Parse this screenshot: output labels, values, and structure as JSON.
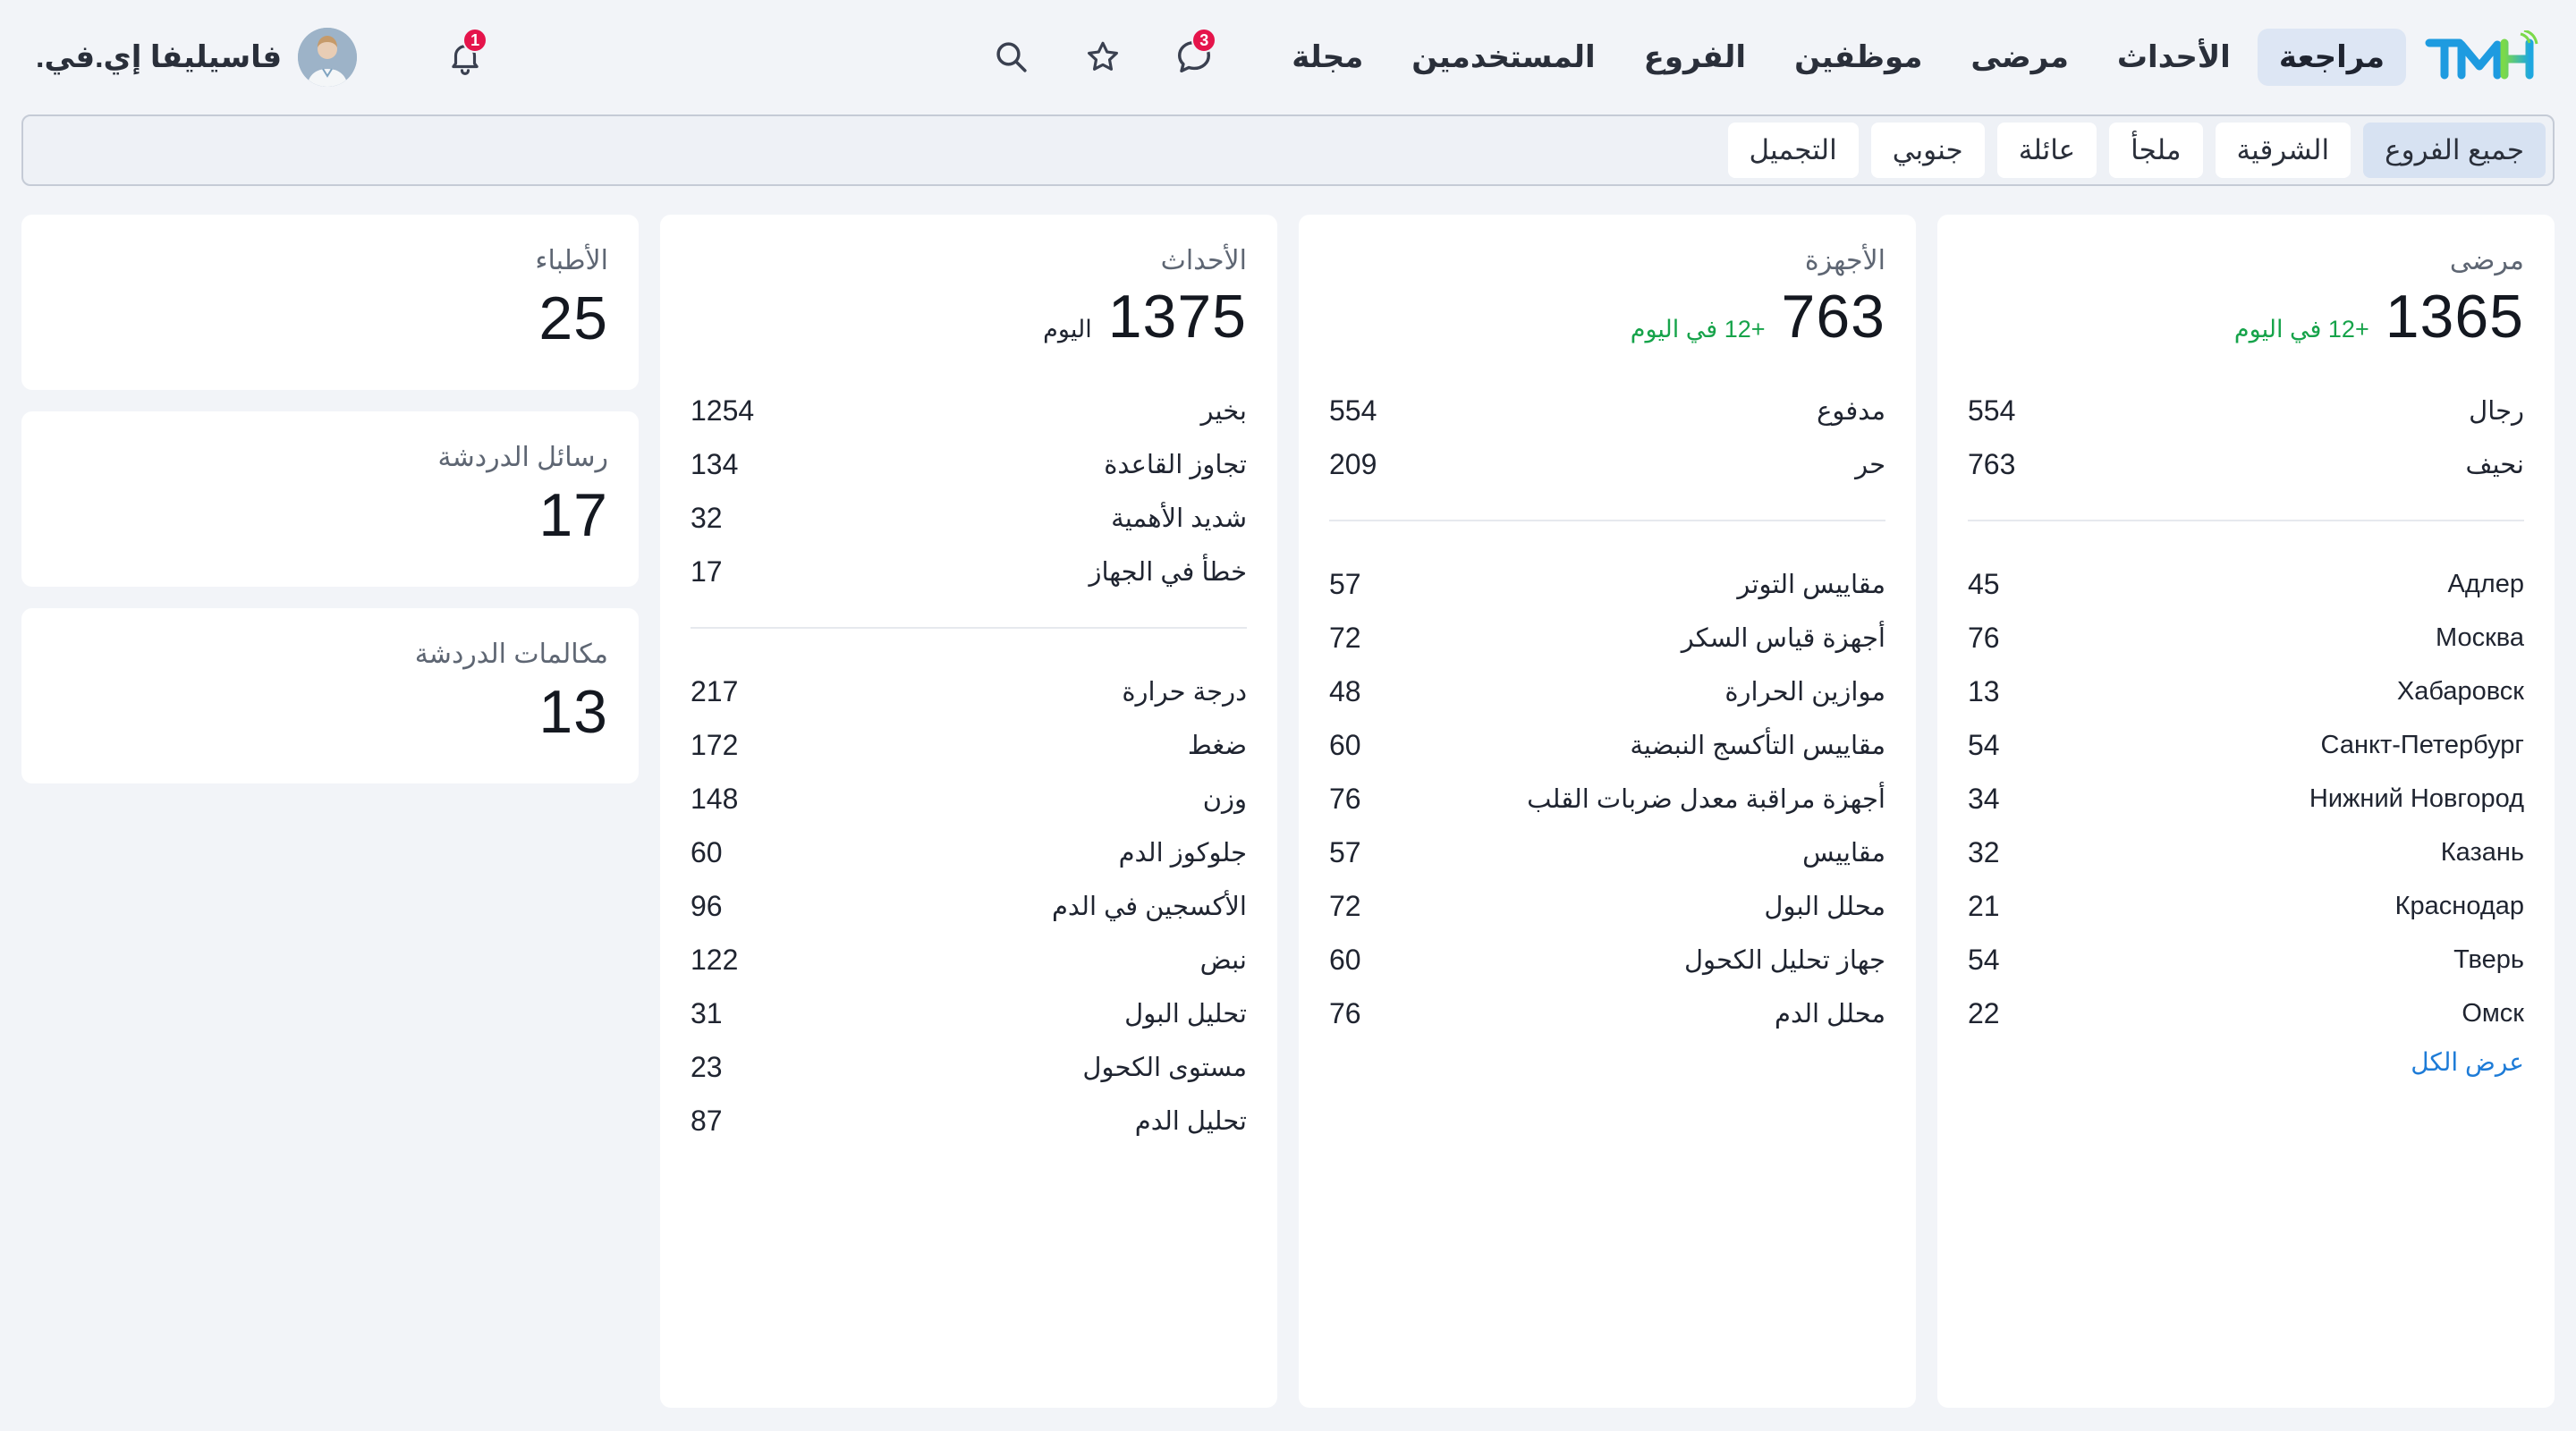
{
  "header": {
    "logo_text": "TMH",
    "nav": [
      "مراجعة",
      "الأحداث",
      "مرضى",
      "موظفين",
      "الفروع",
      "المستخدمين",
      "مجلة"
    ],
    "chat_badge": "3",
    "notif_badge": "1",
    "user_name": "فاسيليفا إي.في."
  },
  "filters": [
    "جميع الفروع",
    "الشرقية",
    "ملجأ",
    "عائلة",
    "جنوبي",
    "التجميل"
  ],
  "patients": {
    "title": "مرضى",
    "total": "1365",
    "delta": "+12 في اليوم",
    "group1": [
      {
        "label": "رجال",
        "value": "554"
      },
      {
        "label": "نحيف",
        "value": "763"
      }
    ],
    "group2": [
      {
        "label": "Адлер",
        "value": "45"
      },
      {
        "label": "Москва",
        "value": "76"
      },
      {
        "label": "Хабаровск",
        "value": "13"
      },
      {
        "label": "Санкт-Петербург",
        "value": "54"
      },
      {
        "label": "Нижний Новгород",
        "value": "34"
      },
      {
        "label": "Казань",
        "value": "32"
      },
      {
        "label": "Краснодар",
        "value": "21"
      },
      {
        "label": "Тверь",
        "value": "54"
      },
      {
        "label": "Омск",
        "value": "22"
      }
    ],
    "show_all": "عرض الكل"
  },
  "devices": {
    "title": "الأجهزة",
    "total": "763",
    "delta": "+12 في اليوم",
    "group1": [
      {
        "label": "مدفوع",
        "value": "554"
      },
      {
        "label": "حر",
        "value": "209"
      }
    ],
    "group2": [
      {
        "label": "مقاييس التوتر",
        "value": "57"
      },
      {
        "label": "أجهزة قياس السكر",
        "value": "72"
      },
      {
        "label": "موازين الحرارة",
        "value": "48"
      },
      {
        "label": "مقاييس التأكسج النبضية",
        "value": "60"
      },
      {
        "label": "أجهزة مراقبة معدل ضربات القلب",
        "value": "76"
      },
      {
        "label": "مقاييس",
        "value": "57"
      },
      {
        "label": "محلل البول",
        "value": "72"
      },
      {
        "label": "جهاز تحليل الكحول",
        "value": "60"
      },
      {
        "label": "محلل الدم",
        "value": "76"
      }
    ]
  },
  "events": {
    "title": "الأحداث",
    "total": "1375",
    "sub": "اليوم",
    "group1": [
      {
        "label": "بخير",
        "value": "1254"
      },
      {
        "label": "تجاوز القاعدة",
        "value": "134"
      },
      {
        "label": "شديد الأهمية",
        "value": "32"
      },
      {
        "label": "خطأ في الجهاز",
        "value": "17"
      }
    ],
    "group2": [
      {
        "label": "درجة حرارة",
        "value": "217"
      },
      {
        "label": "ضغط",
        "value": "172"
      },
      {
        "label": "وزن",
        "value": "148"
      },
      {
        "label": "جلوكوز الدم",
        "value": "60"
      },
      {
        "label": "الأكسجين في الدم",
        "value": "96"
      },
      {
        "label": "نبض",
        "value": "122"
      },
      {
        "label": "تحليل البول",
        "value": "31"
      },
      {
        "label": "مستوى الكحول",
        "value": "23"
      },
      {
        "label": "تحليل الدم",
        "value": "87"
      }
    ]
  },
  "doctors": {
    "title": "الأطباء",
    "value": "25"
  },
  "chat_messages": {
    "title": "رسائل الدردشة",
    "value": "17"
  },
  "chat_calls": {
    "title": "مكالمات الدردشة",
    "value": "13"
  }
}
